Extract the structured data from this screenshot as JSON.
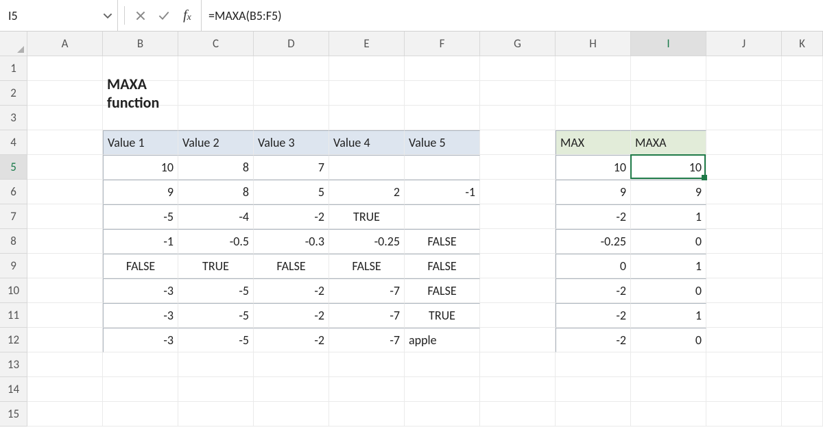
{
  "active_cell": "I5",
  "formula": "=MAXA(B5:F5)",
  "col_headers": [
    "A",
    "B",
    "C",
    "D",
    "E",
    "F",
    "G",
    "H",
    "I",
    "J",
    "K"
  ],
  "row_headers": [
    "1",
    "2",
    "3",
    "4",
    "5",
    "6",
    "7",
    "8",
    "9",
    "10",
    "11",
    "12",
    "13",
    "14",
    "15"
  ],
  "title": "MAXA function",
  "left_table": {
    "headers": [
      "Value 1",
      "Value 2",
      "Value 3",
      "Value 4",
      "Value 5"
    ],
    "rows": [
      [
        "10",
        "8",
        "7",
        "",
        ""
      ],
      [
        "9",
        "8",
        "5",
        "2",
        "-1"
      ],
      [
        "-5",
        "-4",
        "-2",
        "TRUE",
        ""
      ],
      [
        "-1",
        "-0.5",
        "-0.3",
        "-0.25",
        "FALSE"
      ],
      [
        "FALSE",
        "TRUE",
        "FALSE",
        "FALSE",
        "FALSE"
      ],
      [
        "-3",
        "-5",
        "-2",
        "-7",
        "FALSE"
      ],
      [
        "-3",
        "-5",
        "-2",
        "-7",
        "TRUE"
      ],
      [
        "-3",
        "-5",
        "-2",
        "-7",
        "apple"
      ]
    ]
  },
  "right_table": {
    "headers": [
      "MAX",
      "MAXA"
    ],
    "rows": [
      [
        "10",
        "10"
      ],
      [
        "9",
        "9"
      ],
      [
        "-2",
        "1"
      ],
      [
        "-0.25",
        "0"
      ],
      [
        "0",
        "1"
      ],
      [
        "-2",
        "0"
      ],
      [
        "-2",
        "1"
      ],
      [
        "-2",
        "0"
      ]
    ]
  },
  "chart_data": {
    "type": "table",
    "title": "MAXA function",
    "left": {
      "columns": [
        "Value 1",
        "Value 2",
        "Value 3",
        "Value 4",
        "Value 5"
      ],
      "data": [
        [
          10,
          8,
          7,
          null,
          null
        ],
        [
          9,
          8,
          5,
          2,
          -1
        ],
        [
          -5,
          -4,
          -2,
          true,
          null
        ],
        [
          -1,
          -0.5,
          -0.3,
          -0.25,
          false
        ],
        [
          false,
          true,
          false,
          false,
          false
        ],
        [
          -3,
          -5,
          -2,
          -7,
          false
        ],
        [
          -3,
          -5,
          -2,
          -7,
          true
        ],
        [
          -3,
          -5,
          -2,
          -7,
          "apple"
        ]
      ]
    },
    "right": {
      "columns": [
        "MAX",
        "MAXA"
      ],
      "data": [
        [
          10,
          10
        ],
        [
          9,
          9
        ],
        [
          -2,
          1
        ],
        [
          -0.25,
          0
        ],
        [
          0,
          1
        ],
        [
          -2,
          0
        ],
        [
          -2,
          1
        ],
        [
          -2,
          0
        ]
      ]
    }
  }
}
